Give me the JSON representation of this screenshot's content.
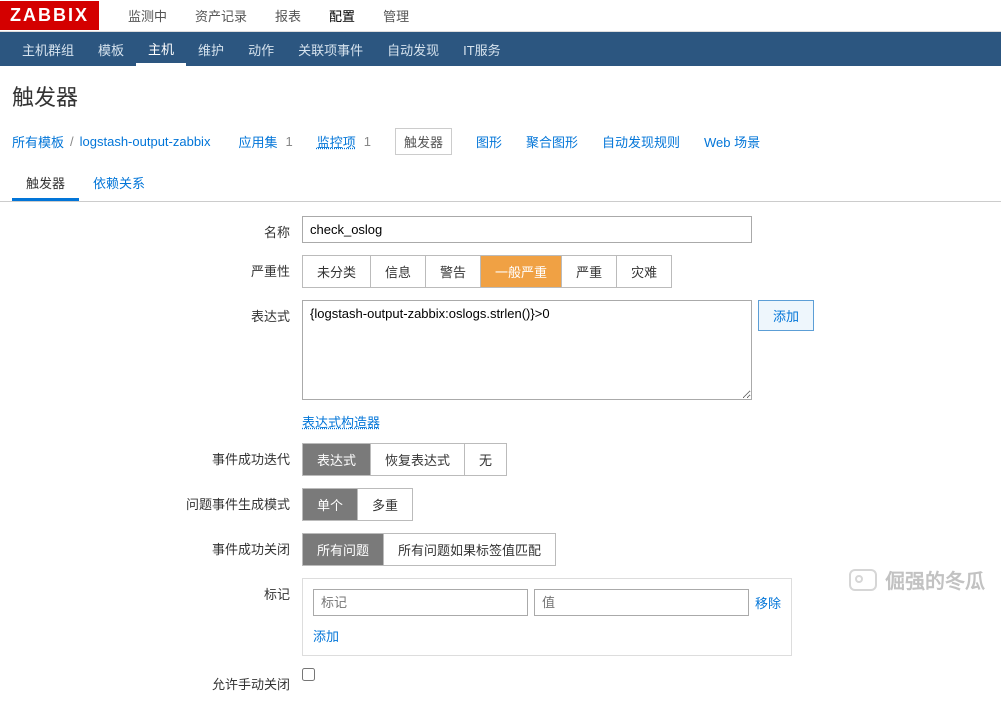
{
  "logo": "ZABBIX",
  "topNav": {
    "items": [
      "监测中",
      "资产记录",
      "报表",
      "配置",
      "管理"
    ],
    "activeIndex": 3
  },
  "subNav": {
    "items": [
      "主机群组",
      "模板",
      "主机",
      "维护",
      "动作",
      "关联项事件",
      "自动发现",
      "IT服务"
    ],
    "activeIndex": 2
  },
  "pageTitle": "触发器",
  "breadcrumb": {
    "allTemplates": "所有模板",
    "templateName": "logstash-output-zabbix",
    "apps": "应用集",
    "appsCount": "1",
    "items": "监控项",
    "itemsCount": "1",
    "triggers": "触发器",
    "graphs": "图形",
    "aggGraphs": "聚合图形",
    "discovery": "自动发现规则",
    "web": "Web 场景"
  },
  "tabs": {
    "trigger": "触发器",
    "deps": "依赖关系"
  },
  "form": {
    "labels": {
      "name": "名称",
      "severity": "严重性",
      "expression": "表达式",
      "okIter": "事件成功迭代",
      "problemMode": "问题事件生成模式",
      "okClose": "事件成功关闭",
      "tags": "标记",
      "allowManual": "允许手动关闭"
    },
    "name": "check_oslog",
    "severity": {
      "options": [
        "未分类",
        "信息",
        "警告",
        "一般严重",
        "严重",
        "灾难"
      ],
      "selectedIndex": 3
    },
    "expression": "{logstash-output-zabbix:oslogs.strlen()}>0",
    "addBtn": "添加",
    "exprBuilder": "表达式构造器",
    "okIter": {
      "options": [
        "表达式",
        "恢复表达式",
        "无"
      ],
      "selectedIndex": 0
    },
    "problemMode": {
      "options": [
        "单个",
        "多重"
      ],
      "selectedIndex": 0
    },
    "okClose": {
      "options": [
        "所有问题",
        "所有问题如果标签值匹配"
      ],
      "selectedIndex": 0
    },
    "tags": {
      "tagPlaceholder": "标记",
      "valuePlaceholder": "值",
      "remove": "移除",
      "add": "添加"
    }
  },
  "watermark": "倔强的冬瓜"
}
